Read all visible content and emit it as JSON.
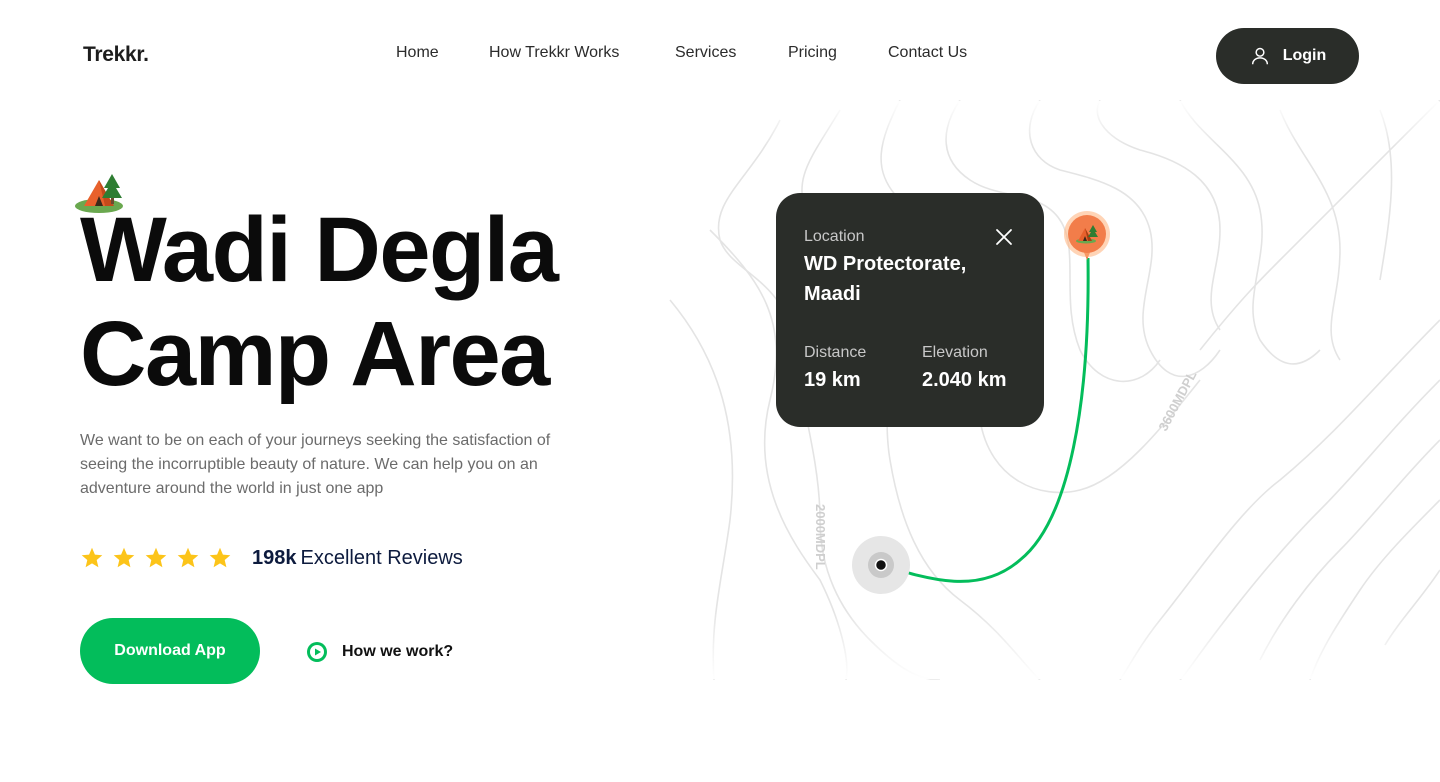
{
  "header": {
    "logo": "Trekkr.",
    "nav": [
      "Home",
      "How Trekkr Works",
      "Services",
      "Pricing",
      "Contact Us"
    ],
    "login_label": "Login"
  },
  "hero": {
    "title_line1": "Wadi Degla",
    "title_line2": "Camp Area",
    "description": "We want to be on each of your journeys seeking the satisfaction of seeing the incorruptible beauty of nature. We can help you on an adventure around the world in just one app",
    "rating_stars": 5,
    "reviews_count": "198k",
    "reviews_label": "Excellent Reviews",
    "download_label": "Download App",
    "how_label": "How we work?"
  },
  "map": {
    "contour_label_1": "3600MDPL",
    "contour_label_2": "2000MDPL",
    "card": {
      "location_label": "Location",
      "location_line1": "WD Protectorate,",
      "location_line2": "Maadi",
      "distance_label": "Distance",
      "distance_value": "19 km",
      "elevation_label": "Elevation",
      "elevation_value": "2.040 km"
    }
  },
  "colors": {
    "accent": "#03bd5b",
    "dark": "#2a2d29",
    "star": "#fcc419",
    "pin": "#f27d4a"
  }
}
